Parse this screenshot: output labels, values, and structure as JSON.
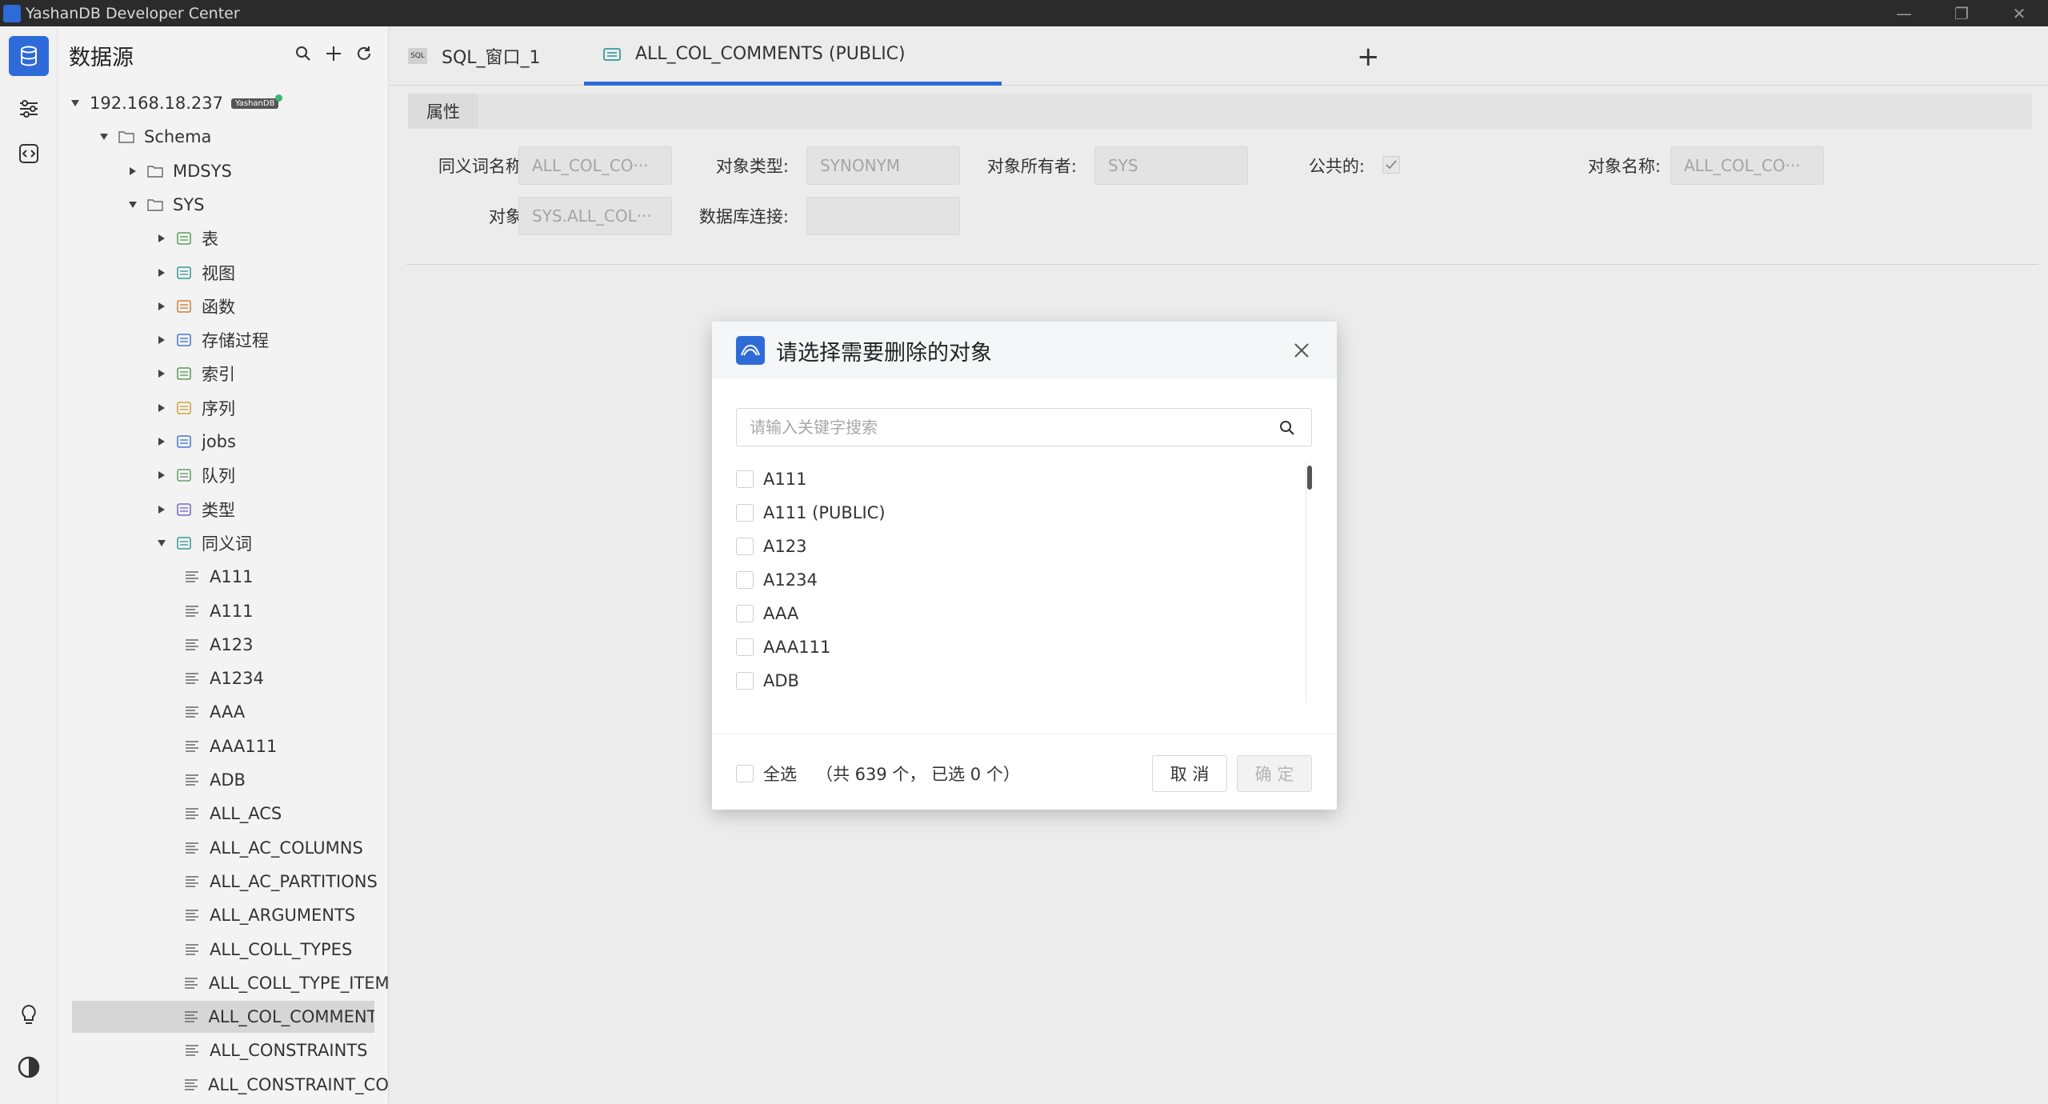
{
  "window": {
    "title": "YashanDB Developer Center",
    "controls": [
      "—",
      "❐",
      "✕"
    ]
  },
  "sidebar": {
    "title": "数据源",
    "connection": {
      "host": "192.168.18.237",
      "badge": "YashanDB"
    },
    "tree": [
      {
        "label": "Schema",
        "type": "folder",
        "level": 1,
        "expanded": true
      },
      {
        "label": "MDSYS",
        "type": "folder",
        "level": 2,
        "expanded": false
      },
      {
        "label": "SYS",
        "type": "folder",
        "level": 2,
        "expanded": true
      },
      {
        "label": "表",
        "type": "table",
        "level": 3,
        "expanded": false
      },
      {
        "label": "视图",
        "type": "view",
        "level": 3,
        "expanded": false
      },
      {
        "label": "函数",
        "type": "function",
        "level": 3,
        "expanded": false
      },
      {
        "label": "存储过程",
        "type": "procedure",
        "level": 3,
        "expanded": false
      },
      {
        "label": "索引",
        "type": "index",
        "level": 3,
        "expanded": false
      },
      {
        "label": "序列",
        "type": "sequence",
        "level": 3,
        "expanded": false
      },
      {
        "label": "jobs",
        "type": "job",
        "level": 3,
        "expanded": false
      },
      {
        "label": "队列",
        "type": "queue",
        "level": 3,
        "expanded": false
      },
      {
        "label": "类型",
        "type": "type",
        "level": 3,
        "expanded": false
      },
      {
        "label": "同义词",
        "type": "synonym",
        "level": 3,
        "expanded": true
      }
    ],
    "synonyms": [
      "A111",
      "A111",
      "A123",
      "A1234",
      "AAA",
      "AAA111",
      "ADB",
      "ALL_ACS",
      "ALL_AC_COLUMNS",
      "ALL_AC_PARTITIONS",
      "ALL_ARGUMENTS",
      "ALL_COLL_TYPES",
      "ALL_COLL_TYPE_ITEMS",
      "ALL_COL_COMMENTS",
      "ALL_CONSTRAINTS",
      "ALL_CONSTRAINT_COLUMNS"
    ],
    "selected_synonym": "ALL_COL_COMMENTS"
  },
  "tabs": [
    {
      "label": "SQL_窗口_1",
      "icon": "sql-icon",
      "active": false
    },
    {
      "label": "ALL_COL_COMMENTS (PUBLIC)",
      "icon": "synonym-icon",
      "active": true
    }
  ],
  "tab_add_label": "+",
  "properties": {
    "subtab": "属性",
    "synonym_name_label": "同义词名称:",
    "synonym_name_value": "ALL_COL_CO···",
    "object_type_label": "对象类型:",
    "object_type_value": "SYNONYM",
    "owner_label": "对象所有者:",
    "owner_value": "SYS",
    "public_label": "公共的:",
    "public_checked": true,
    "object_name_label": "对象名称:",
    "object_name_value": "ALL_COL_CO···",
    "object_label": "对象:",
    "object_value": "SYS.ALL_COL···",
    "dblink_label": "数据库连接:",
    "dblink_value": ""
  },
  "dialog": {
    "title": "请选择需要删除的对象",
    "search_placeholder": "请输入关键字搜索",
    "items": [
      "A111",
      "A111 (PUBLIC)",
      "A123",
      "A1234",
      "AAA",
      "AAA111",
      "ADB"
    ],
    "select_all_label": "全选",
    "count_text": "（共 639 个， 已选 0 个）",
    "cancel_label": "取 消",
    "confirm_label": "确 定"
  }
}
